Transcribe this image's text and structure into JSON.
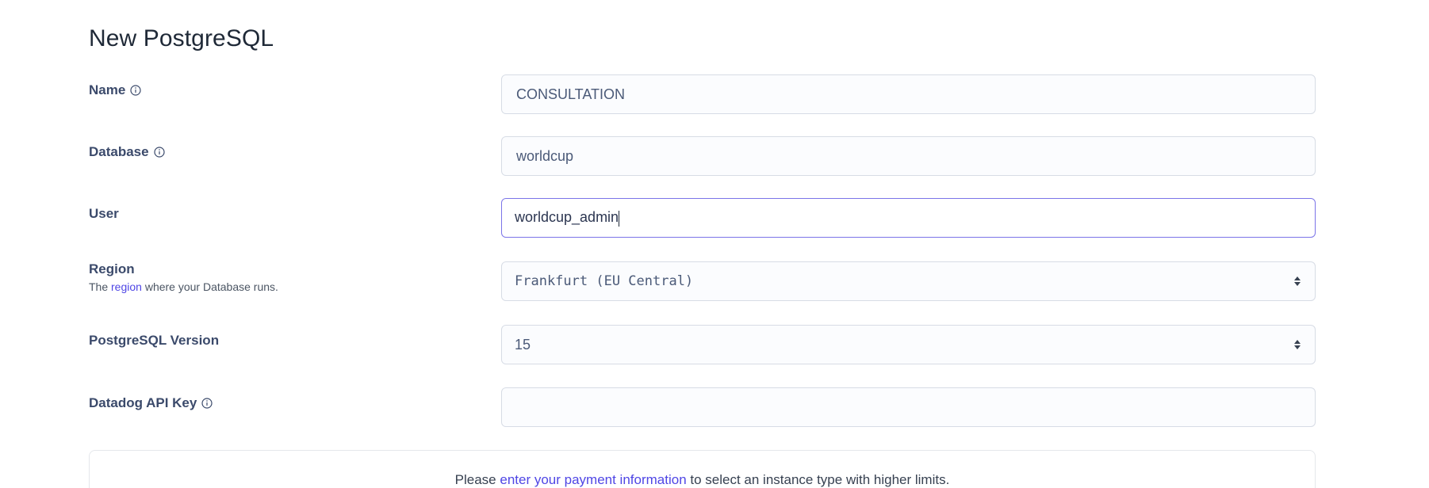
{
  "page_title": "New PostgreSQL",
  "form": {
    "name": {
      "label": "Name",
      "value": "CONSULTATION"
    },
    "database": {
      "label": "Database",
      "value": "worldcup"
    },
    "user": {
      "label": "User",
      "value": "worldcup_admin"
    },
    "region": {
      "label": "Region",
      "help_prefix": "The ",
      "help_link": "region",
      "help_suffix": " where your Database runs.",
      "selected": "Frankfurt (EU Central)"
    },
    "version": {
      "label": "PostgreSQL Version",
      "selected": "15"
    },
    "datadog": {
      "label": "Datadog API Key",
      "value": ""
    }
  },
  "notice": {
    "prefix": "Please ",
    "link": "enter your payment information",
    "suffix": " to select an instance type with higher limits."
  },
  "icons": {
    "info": "info-circle-icon",
    "select": "chevron-up-down-icon"
  },
  "colors": {
    "accent": "#4f46e5",
    "focus_border": "#7b74e8",
    "label": "#3b4a6b"
  }
}
